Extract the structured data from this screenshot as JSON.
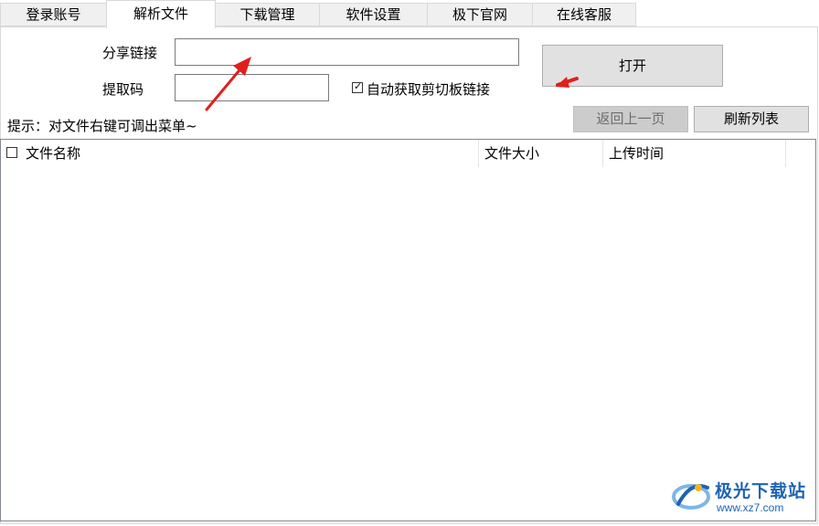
{
  "tabs": [
    {
      "label": "登录账号"
    },
    {
      "label": "解析文件"
    },
    {
      "label": "下载管理"
    },
    {
      "label": "软件设置"
    },
    {
      "label": "极下官网"
    },
    {
      "label": "在线客服"
    }
  ],
  "active_tab": "解析文件",
  "form": {
    "share_link_label": "分享链接",
    "share_link_value": "",
    "extract_code_label": "提取码",
    "extract_code_value": "",
    "auto_clipboard_label": "自动获取剪切板链接",
    "auto_clipboard_checked": true,
    "open_button": "打开"
  },
  "hint": "提示：对文件右键可调出菜单~",
  "toolbar": {
    "back_button": "返回上一页",
    "back_enabled": false,
    "refresh_button": "刷新列表"
  },
  "file_list": {
    "columns": [
      "文件名称",
      "文件大小",
      "上传时间"
    ],
    "rows": []
  },
  "watermark": {
    "title": "极光下载站",
    "url": "www.xz7.com"
  },
  "colors": {
    "arrow": "#e0201c",
    "logo": "#1e63b6",
    "disabled_button": "#cccccc"
  }
}
